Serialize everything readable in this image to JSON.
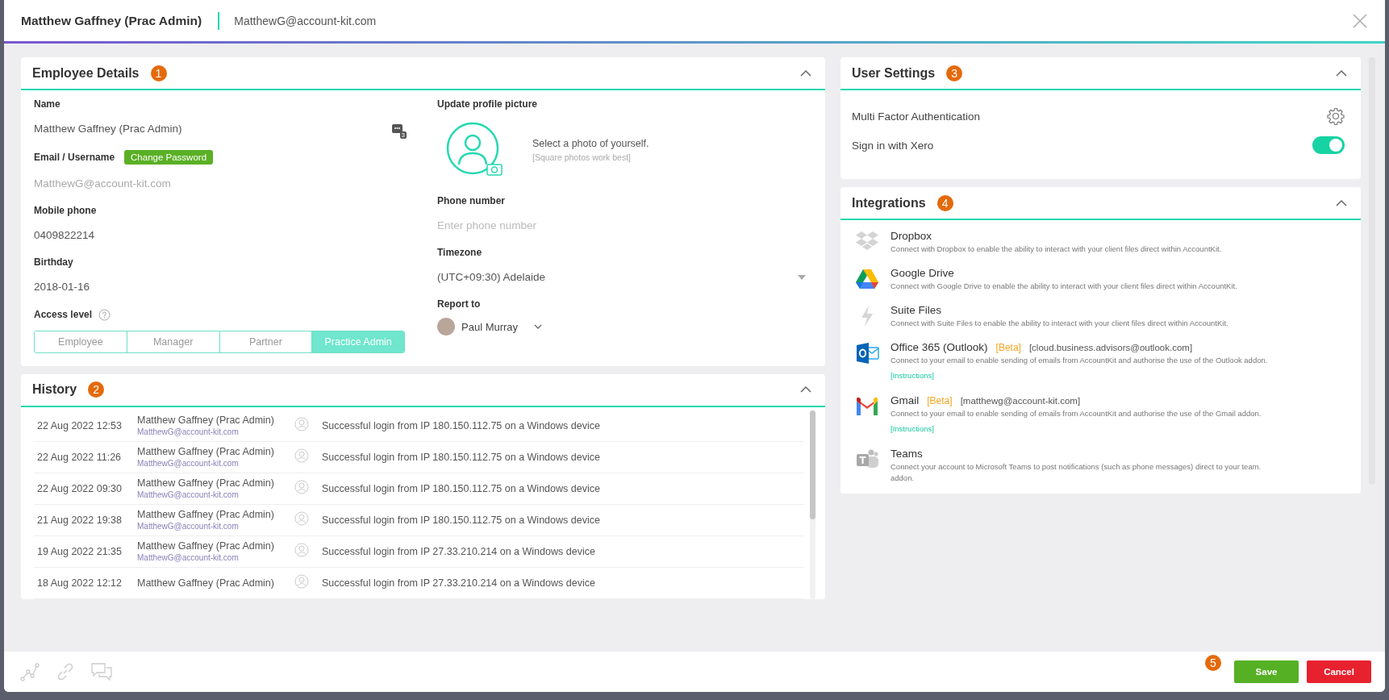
{
  "header": {
    "title": "Matthew Gaffney (Prac Admin)",
    "email": "MatthewG@account-kit.com"
  },
  "employee_details": {
    "title": "Employee Details",
    "marker": "1",
    "expanded": true,
    "name_label": "Name",
    "name_value": "Matthew Gaffney (Prac Admin)",
    "name_badge": "3",
    "email_label": "Email / Username",
    "change_password": "Change Password",
    "email_value": "MatthewG@account-kit.com",
    "mobile_label": "Mobile phone",
    "mobile_value": "0409822214",
    "birthday_label": "Birthday",
    "birthday_value": "2018-01-16",
    "access_label": "Access level",
    "access_levels": [
      {
        "label": "Employee",
        "selected": false
      },
      {
        "label": "Manager",
        "selected": false
      },
      {
        "label": "Partner",
        "selected": false
      },
      {
        "label": "Practice Admin",
        "selected": true
      }
    ],
    "picture_label": "Update profile picture",
    "picture_hint": "Select a photo of yourself.",
    "picture_subhint": "[Square photos work best]",
    "phone_label": "Phone number",
    "phone_placeholder": "Enter phone number",
    "timezone_label": "Timezone",
    "timezone_value": "(UTC+09:30) Adelaide",
    "report_label": "Report to",
    "report_value": "Paul Murray"
  },
  "history": {
    "title": "History",
    "marker": "2",
    "expanded": true,
    "rows": [
      {
        "time": "22 Aug 2022 12:53",
        "user": "Matthew Gaffney (Prac Admin)",
        "email": "MatthewG@account-kit.com",
        "message": "Successful login from IP 180.150.112.75 on a Windows device"
      },
      {
        "time": "22 Aug 2022 11:26",
        "user": "Matthew Gaffney (Prac Admin)",
        "email": "MatthewG@account-kit.com",
        "message": "Successful login from IP 180.150.112.75 on a Windows device"
      },
      {
        "time": "22 Aug 2022 09:30",
        "user": "Matthew Gaffney (Prac Admin)",
        "email": "MatthewG@account-kit.com",
        "message": "Successful login from IP 180.150.112.75 on a Windows device"
      },
      {
        "time": "21 Aug 2022 19:38",
        "user": "Matthew Gaffney (Prac Admin)",
        "email": "MatthewG@account-kit.com",
        "message": "Successful login from IP 180.150.112.75 on a Windows device"
      },
      {
        "time": "19 Aug 2022 21:35",
        "user": "Matthew Gaffney (Prac Admin)",
        "email": "MatthewG@account-kit.com",
        "message": "Successful login from IP 27.33.210.214 on a Windows device"
      },
      {
        "time": "18 Aug 2022 12:12",
        "user": "Matthew Gaffney (Prac Admin)",
        "message": "Successful login from IP 27.33.210.214 on a Windows device"
      }
    ]
  },
  "user_settings": {
    "title": "User Settings",
    "marker": "3",
    "expanded": true,
    "items": [
      {
        "kind": "gear",
        "label": "Multi Factor Authentication"
      },
      {
        "kind": "toggle",
        "label": "Sign in with Xero",
        "on": true
      }
    ]
  },
  "integrations": {
    "title": "Integrations",
    "marker": "4",
    "expanded": true,
    "items": [
      {
        "kind": "dropbox",
        "name": "Dropbox",
        "description": "Connect with Dropbox to enable the ability to interact with your client files direct within AccountKit."
      },
      {
        "kind": "drive",
        "name": "Google Drive",
        "description": "Connect with Google Drive to enable the ability to interact with your client files direct within AccountKit."
      },
      {
        "kind": "bolt",
        "name": "Suite Files",
        "description": "Connect with Suite Files to enable the ability to interact with your client files direct within AccountKit."
      },
      {
        "kind": "outlook",
        "name": "Office 365 (Outlook)",
        "beta": "[Beta]",
        "account": "[cloud.business.advisors@outlook.com]",
        "description": "Connect to your email to enable sending of emails from AccountKit and authorise the use of the Outlook addon.",
        "link": "[Instructions]"
      },
      {
        "kind": "gmail",
        "name": "Gmail",
        "beta": "[Beta]",
        "account": "[matthewg@account-kit.com]",
        "description": "Connect to your email to enable sending of emails from AccountKit and authorise the use of the Gmail addon.",
        "link": "[Instructions]"
      },
      {
        "kind": "teams",
        "name": "Teams",
        "description": "Connect your account to Microsoft Teams to post notifications (such as phone messages) direct to your team.",
        "note": "addon."
      }
    ]
  },
  "footer": {
    "marker": "5",
    "save": "Save",
    "cancel": "Cancel"
  }
}
